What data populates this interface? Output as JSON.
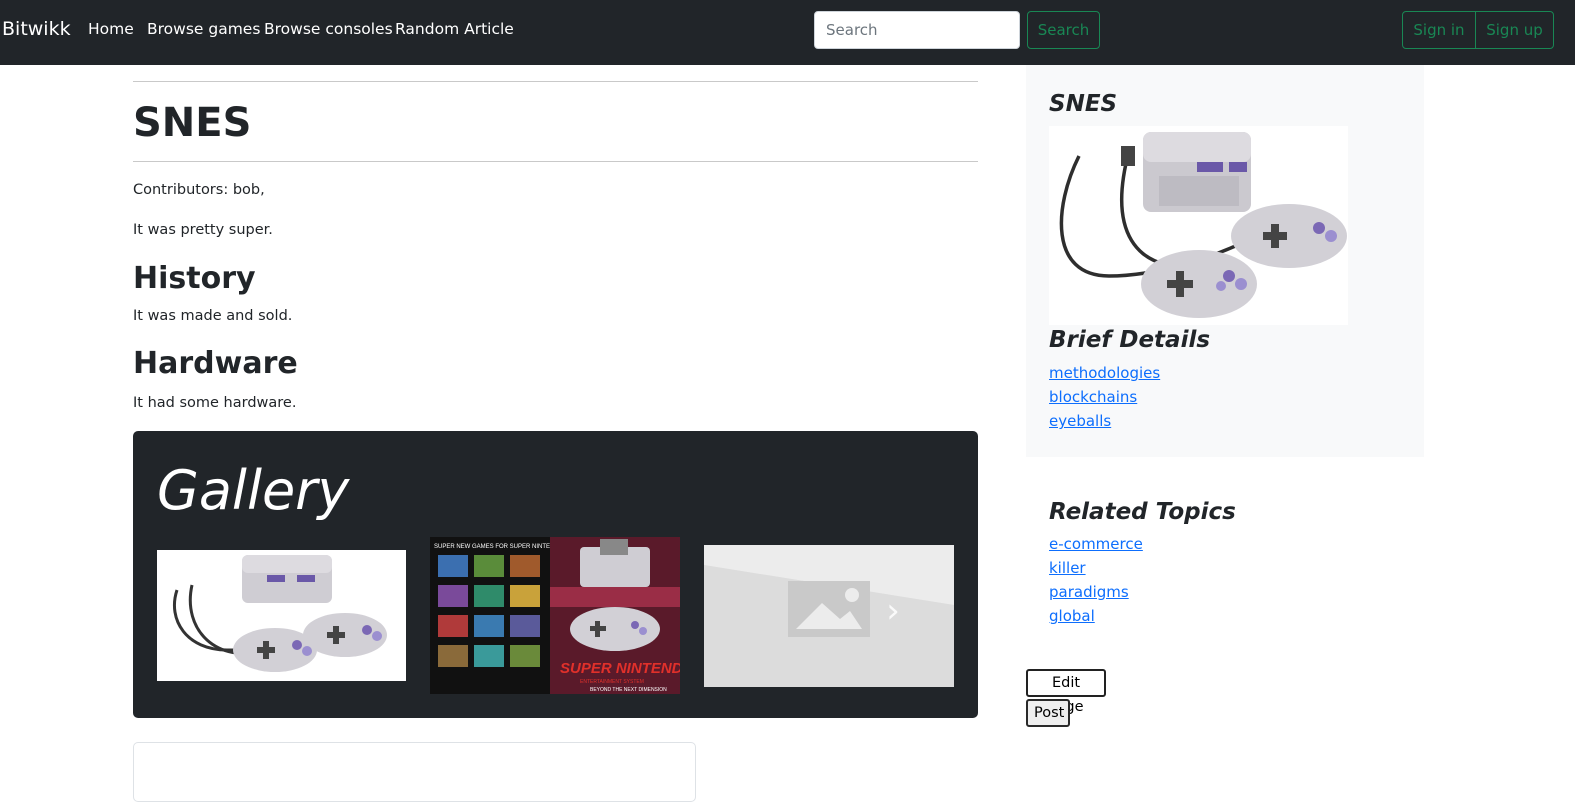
{
  "navbar": {
    "brand": "Bitwikk",
    "links": [
      "Home",
      "Browse games",
      "Browse consoles",
      "Random Article"
    ],
    "search_placeholder": "Search",
    "search_button": "Search",
    "signin": "Sign in",
    "signup": "Sign up"
  },
  "article": {
    "title": "SNES",
    "contributors": "Contributors: bob,",
    "intro": "It was pretty super.",
    "sections": [
      {
        "heading": "History",
        "text": "It was made and sold."
      },
      {
        "heading": "Hardware",
        "text": "It had some hardware."
      }
    ]
  },
  "gallery": {
    "title": "Gallery",
    "images": [
      "snes-console-photo",
      "super-nintendo-ad-photo",
      "image-placeholder-icon"
    ],
    "next_glyph": "›",
    "poster_text": {
      "banner": "SUPER NEW GAMES FOR SUPER NINTENDO",
      "logo": "SUPER NINTENDO",
      "subtitle": "ENTERTAINMENT SYSTEM",
      "tagline": "BEYOND THE NEXT DIMENSION"
    }
  },
  "sidebar": {
    "title": "SNES",
    "brief_heading": "Brief Details",
    "brief_links": [
      "methodologies",
      "blockchains",
      "eyeballs"
    ],
    "related_heading": "Related Topics",
    "related_links": [
      "e-commerce",
      "killer",
      "paradigms",
      "global"
    ],
    "edit_button": "Edit Page",
    "post_button": "Post"
  },
  "colors": {
    "navbar_bg": "#212529",
    "accent_green": "#198754",
    "link_blue": "#0d6efd",
    "sidebar_bg": "#f8f9fa",
    "snes_purple": "#7b68b5"
  }
}
